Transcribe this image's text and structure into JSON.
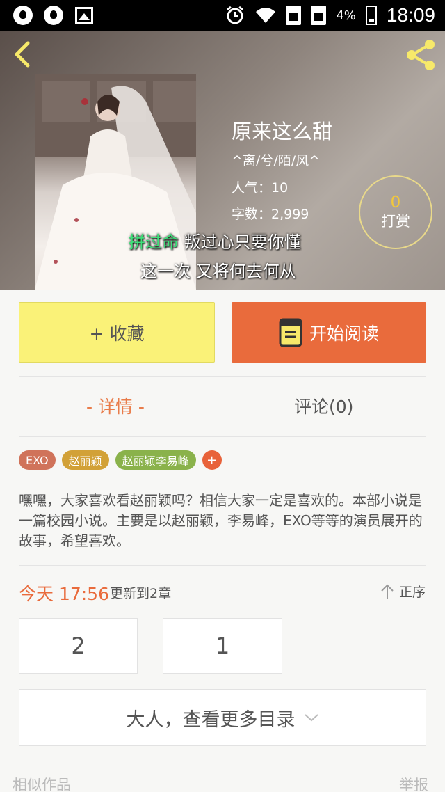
{
  "status_bar": {
    "battery": "4%",
    "time": "18:09"
  },
  "book": {
    "title": "原来这么甜",
    "author": "^离/兮/陌/风^",
    "popularity": "人气：10",
    "word_count": "字数：2,999"
  },
  "reward": {
    "count": "0",
    "label": "打赏"
  },
  "lyrics": {
    "line1_highlight": "拼过命",
    "line1_rest": " 叛过心只要你懂",
    "line2": "这一次 又将何去何从"
  },
  "actions": {
    "favorite": "+ 收藏",
    "start_reading": "开始阅读"
  },
  "tabs": {
    "details": "- 详情 -",
    "comments": "评论(0)"
  },
  "tags": [
    "EXO",
    "赵丽颖",
    "赵丽颖李易峰",
    "+"
  ],
  "description": "嘿嘿，大家喜欢看赵丽颖吗？相信大家一定是喜欢的。本部小说是一篇校园小说。主要是以赵丽颖，李易峰，EXO等等的演员展开的故事，希望喜欢。",
  "update": {
    "time": "今天 17:56",
    "text": "更新到2章",
    "sort": "正序"
  },
  "chapters": [
    "2",
    "1"
  ],
  "more_toc": "大人，查看更多目录",
  "footer": {
    "similar": "相似作品",
    "report": "举报"
  },
  "colors": {
    "accent": "#e96b3c",
    "favorite_bg": "#faf278",
    "tab_active": "#e97c4a"
  }
}
